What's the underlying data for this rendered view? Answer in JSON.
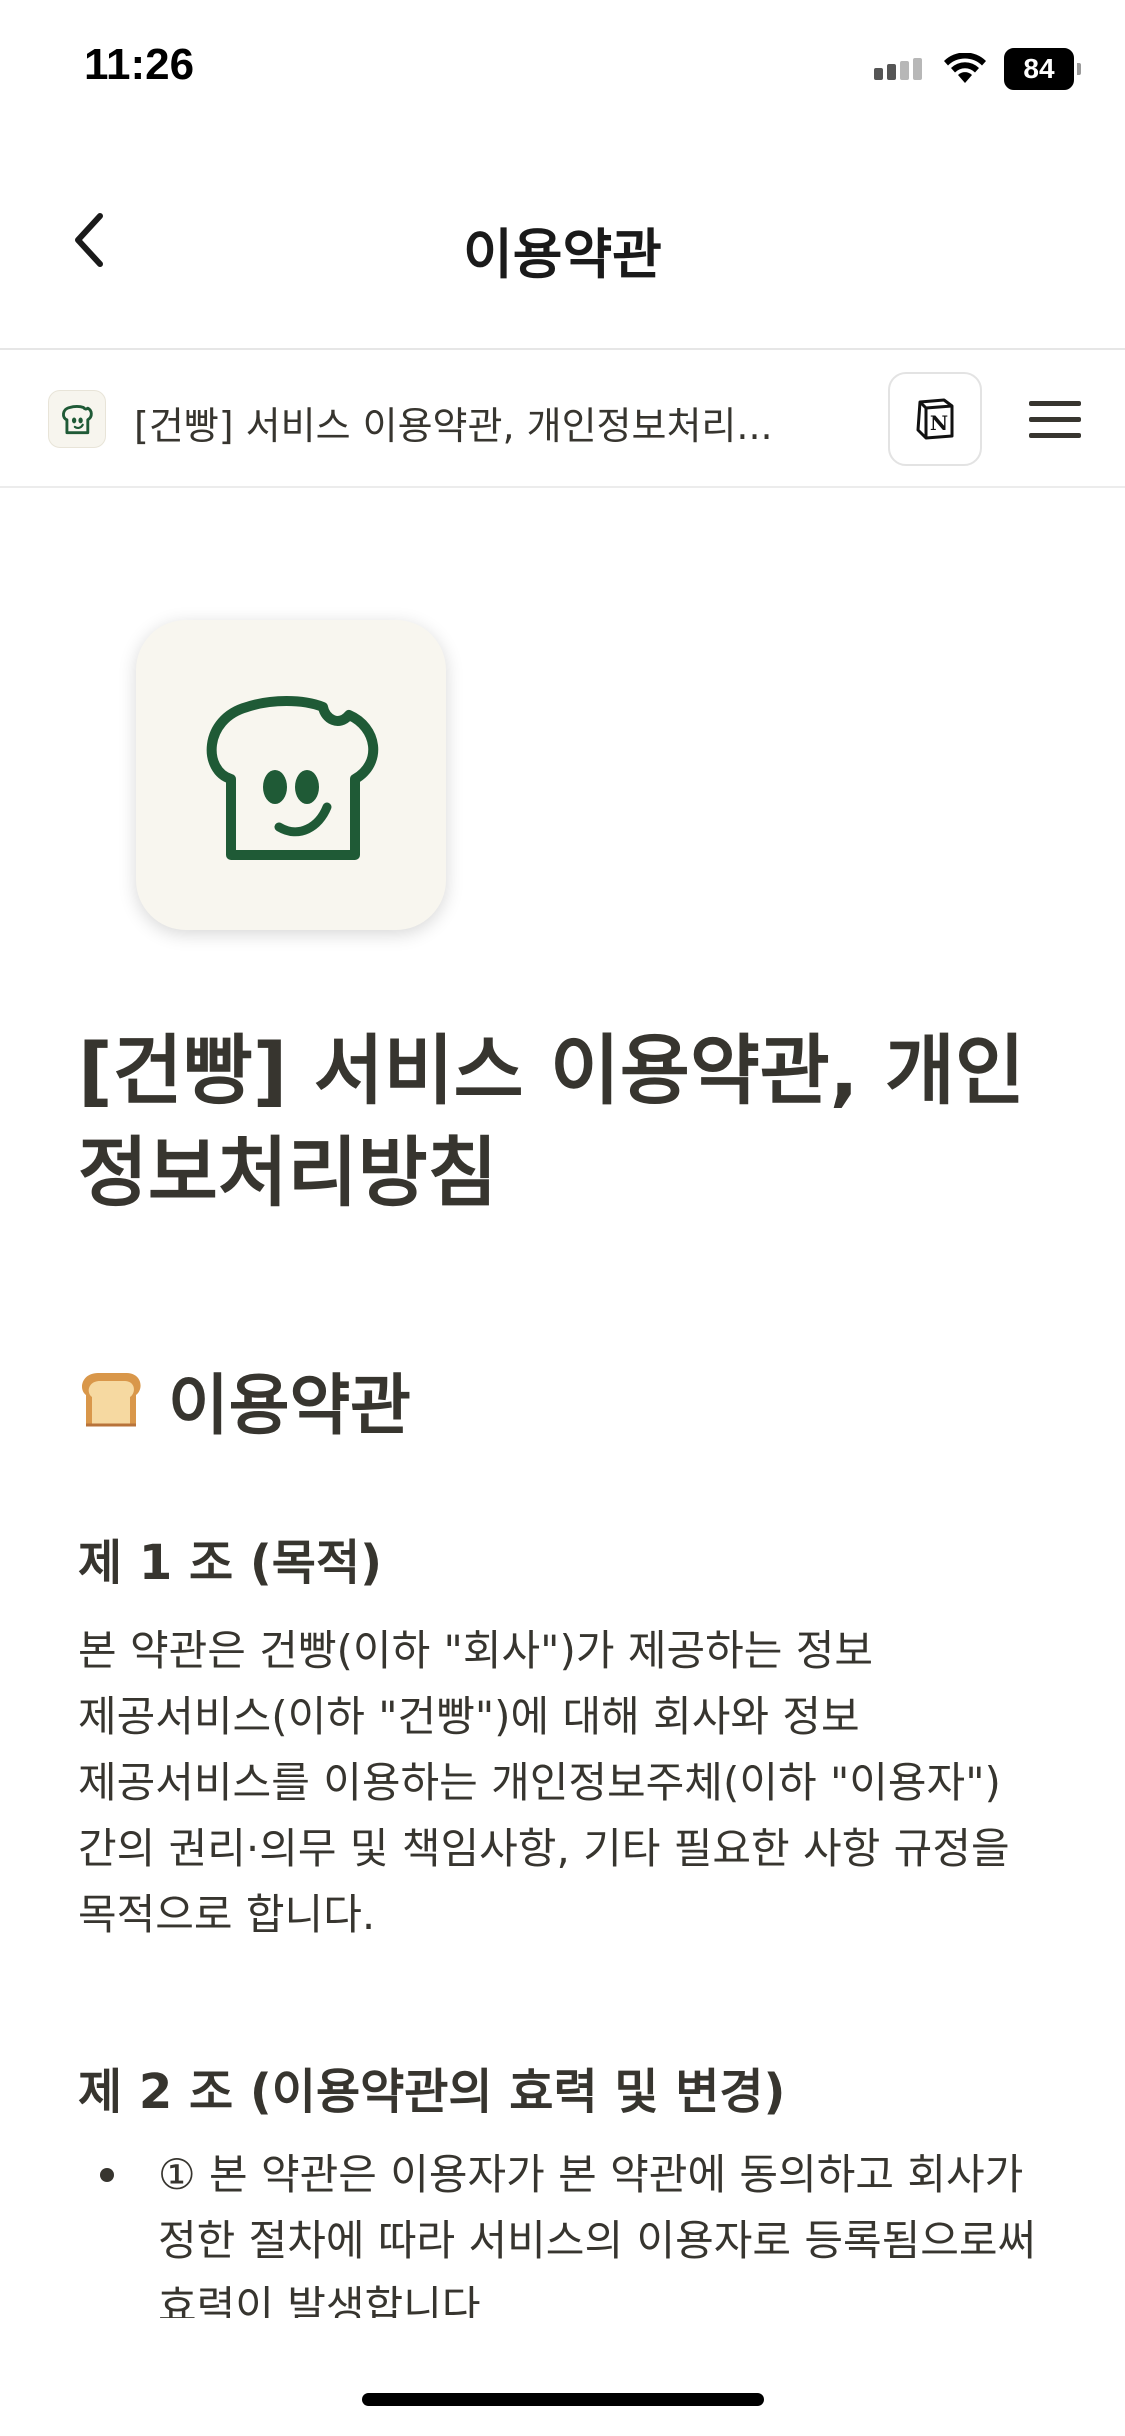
{
  "status_bar": {
    "time": "11:26",
    "battery": "84"
  },
  "header": {
    "title": "이용약관"
  },
  "notion_bar": {
    "breadcrumb": "[건빵] 서비스 이용약관, 개인정보처리..."
  },
  "page": {
    "title": "[건빵] 서비스 이용약관, 개인정보처리방침",
    "section_heading": "이용약관",
    "articles": [
      {
        "heading": "제 1 조 (목적)",
        "body": "본 약관은 건빵(이하 \"회사\")가 제공하는 정보 제공서비스(이하 \"건빵\")에 대해 회사와 정보 제공서비스를 이용하는 개인정보주체(이하 \"이용자\")간의 권리·의무 및 책임사항, 기타 필요한 사항 규정을 목적으로 합니다."
      },
      {
        "heading": "제 2 조 (이용약관의 효력 및 변경)",
        "bullets": [
          "① 본 약관은 이용자가 본 약관에 동의하고 회사가 정한 절차에 따라 서비스의 이용자로 등록됨으로써 효력이 발생합니다"
        ]
      }
    ]
  },
  "icons": {
    "back": "chevron-left-icon",
    "page": "bread-face-icon",
    "notion": "notion-logo-icon",
    "menu": "hamburger-menu-icon",
    "section": "bread-emoji-icon"
  },
  "colors": {
    "brand_green": "#1f5a36",
    "logo_background": "#f8f6ef",
    "text": "#37352f"
  }
}
